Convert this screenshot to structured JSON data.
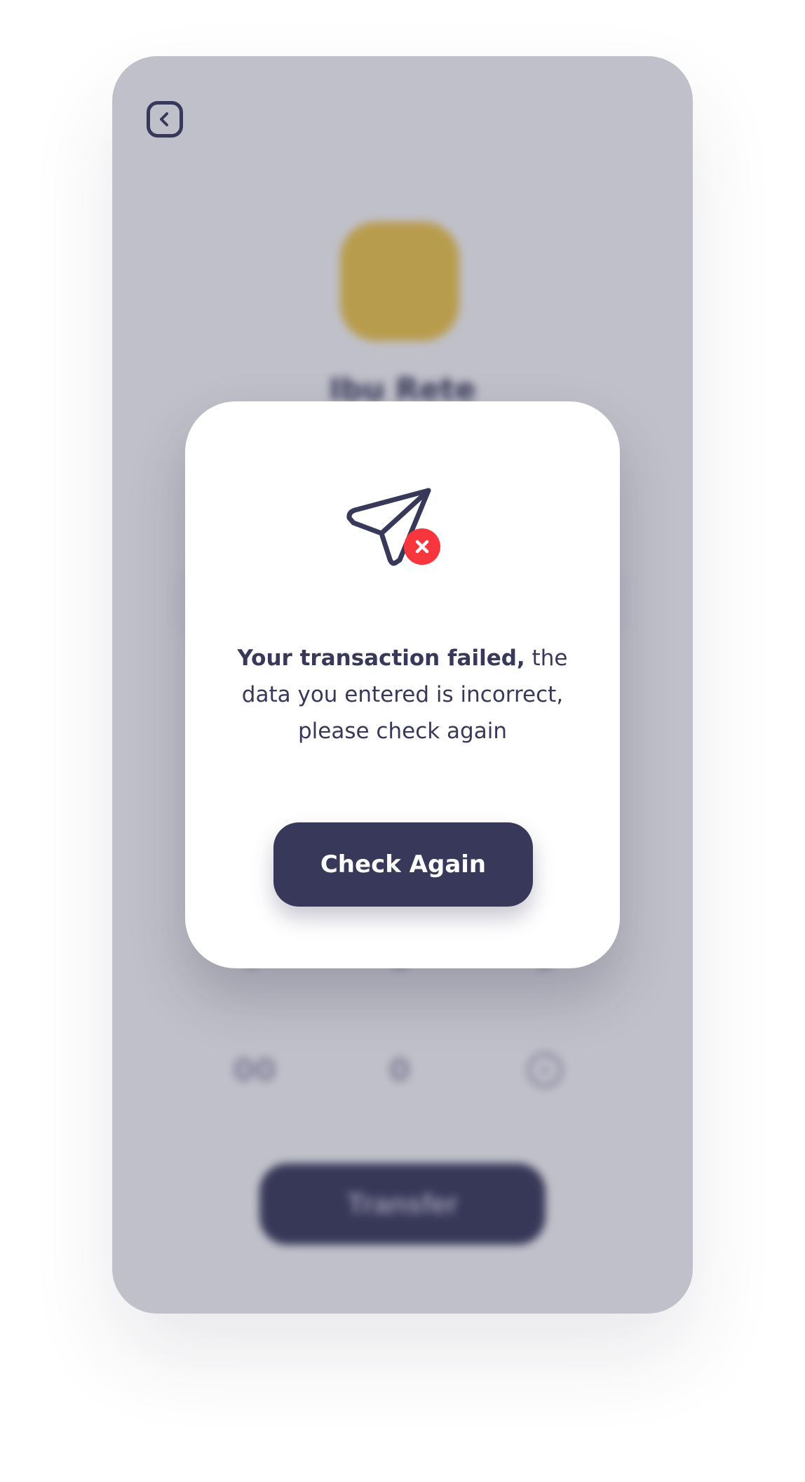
{
  "background": {
    "recipient_name": "Ibu Rete",
    "keypad": {
      "row_top": [
        "7",
        "8",
        "9"
      ],
      "row_bottom": [
        "00",
        "0"
      ],
      "delete_icon": "delete-icon"
    },
    "transfer_label": "Transfer",
    "back_icon": "chevron-left-icon",
    "avatar_color": "#e8c24a"
  },
  "modal": {
    "icon": "paper-plane-icon",
    "error_badge_icon": "close-icon",
    "message_bold": "Your transaction failed,",
    "message_rest": " the data you entered is incorrect, please check again",
    "button_label": "Check Again"
  },
  "colors": {
    "primary": "#38385a",
    "error": "#f9363d",
    "surface": "#ffffff"
  }
}
